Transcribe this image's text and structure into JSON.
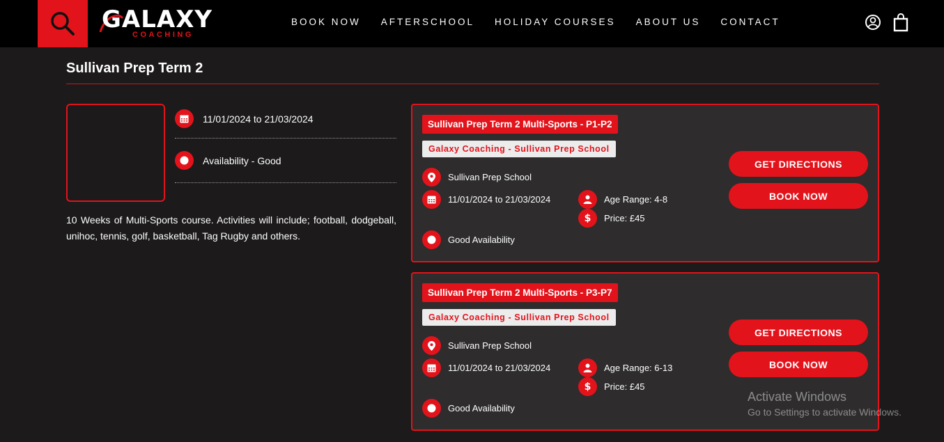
{
  "header": {
    "brand_main": "GALAXY",
    "brand_sub": "COACHING",
    "nav": [
      "BOOK NOW",
      "AFTERSCHOOL",
      "HOLIDAY COURSES",
      "ABOUT US",
      "CONTACT"
    ],
    "icons": [
      "search-icon",
      "user-icon",
      "cart-icon"
    ]
  },
  "page": {
    "title": "Sullivan Prep Term 2",
    "dates": "11/01/2024 to 21/03/2024",
    "availability": "Availability - Good",
    "description": "10 Weeks of Multi-Sports course. Activities will include; football, dodgeball, unihoc, tennis, golf, basketball, Tag Rugby and others."
  },
  "courses": [
    {
      "title": "Sullivan Prep Term 2 Multi-Sports - P1-P2",
      "provider": "Galaxy Coaching - Sullivan Prep School",
      "location": "Sullivan Prep School",
      "dates": "11/01/2024 to 21/03/2024",
      "age_range": "Age Range: 4-8",
      "price": "Price: £45",
      "availability": "Good Availability",
      "directions_label": "GET DIRECTIONS",
      "book_label": "BOOK NOW"
    },
    {
      "title": "Sullivan Prep Term 2 Multi-Sports - P3-P7",
      "provider": "Galaxy Coaching - Sullivan Prep School",
      "location": "Sullivan Prep School",
      "dates": "11/01/2024 to 21/03/2024",
      "age_range": "Age Range: 6-13",
      "price": "Price: £45",
      "availability": "Good Availability",
      "directions_label": "GET DIRECTIONS",
      "book_label": "BOOK NOW"
    }
  ],
  "watermark": {
    "line1": "Activate Windows",
    "line2": "Go to Settings to activate Windows."
  },
  "colors": {
    "accent": "#e3131b",
    "background": "#1c1a1b",
    "card": "#2e2c2d",
    "header": "#000000"
  }
}
